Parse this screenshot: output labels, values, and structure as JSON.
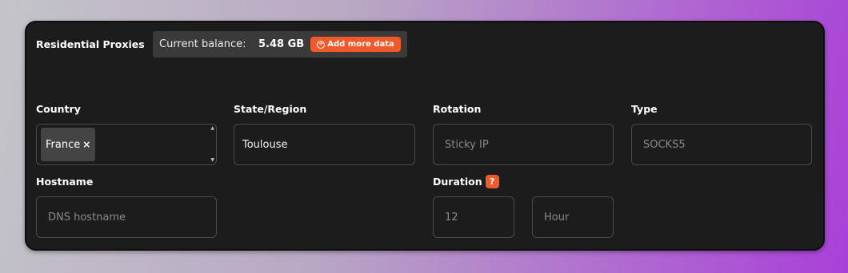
{
  "header": {
    "title": "Residential Proxies",
    "balance_label": "Current balance:",
    "balance_value": "5.48 GB",
    "add_more_label": "Add more data"
  },
  "accent_color": "#f05a2a",
  "form": {
    "country": {
      "label": "Country",
      "selected": "France",
      "remove_glyph": "×"
    },
    "state": {
      "label": "State/Region",
      "value": "Toulouse"
    },
    "rotation": {
      "label": "Rotation",
      "value": "Sticky IP"
    },
    "type": {
      "label": "Type",
      "value": "SOCKS5"
    },
    "hostname": {
      "label": "Hostname",
      "placeholder": "DNS hostname"
    },
    "duration": {
      "label": "Duration",
      "help_glyph": "?",
      "amount": "12",
      "unit": "Hour"
    }
  }
}
